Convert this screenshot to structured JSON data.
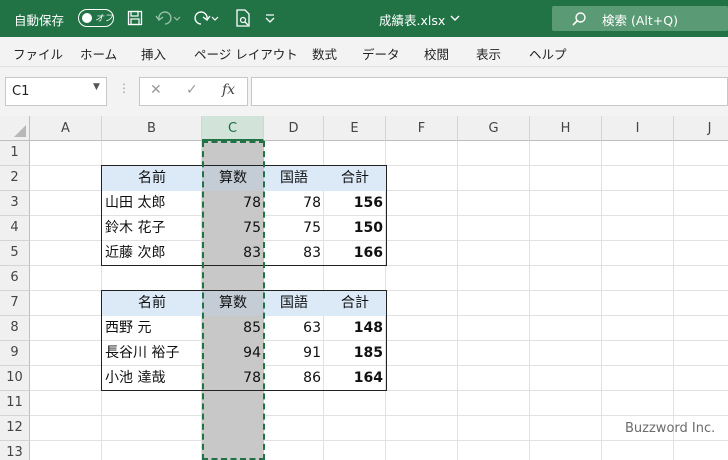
{
  "title_bar": {
    "autosave_label": "自動保存",
    "autosave_state": "オフ",
    "file_name": "成績表.xlsx",
    "search_placeholder": "検索 (Alt+Q)"
  },
  "menu": [
    "ファイル",
    "ホーム",
    "挿入",
    "ページ レイアウト",
    "数式",
    "データ",
    "校閲",
    "表示",
    "ヘルプ"
  ],
  "formula_bar": {
    "name_box": "C1",
    "fx_label": "fx",
    "formula": ""
  },
  "columns": [
    "A",
    "B",
    "C",
    "D",
    "E",
    "F",
    "G",
    "H",
    "I",
    "J"
  ],
  "selected_column": "C",
  "rows": [
    "1",
    "2",
    "3",
    "4",
    "5",
    "6",
    "7",
    "8",
    "9",
    "10",
    "11",
    "12",
    "13"
  ],
  "table1": {
    "headers": [
      "名前",
      "算数",
      "国語",
      "合計"
    ],
    "rows": [
      [
        "山田 太郎",
        "78",
        "78",
        "156"
      ],
      [
        "鈴木 花子",
        "75",
        "75",
        "150"
      ],
      [
        "近藤 次郎",
        "83",
        "83",
        "166"
      ]
    ]
  },
  "table2": {
    "headers": [
      "名前",
      "算数",
      "国語",
      "合計"
    ],
    "rows": [
      [
        "西野 元",
        "85",
        "63",
        "148"
      ],
      [
        "長谷川 裕子",
        "94",
        "91",
        "185"
      ],
      [
        "小池 達哉",
        "78",
        "86",
        "164"
      ]
    ]
  },
  "watermark": "Buzzword Inc.",
  "colors": {
    "excel_green": "#217346",
    "header_fill": "#dce9f7",
    "selection_gray": "#c8c8c8"
  }
}
